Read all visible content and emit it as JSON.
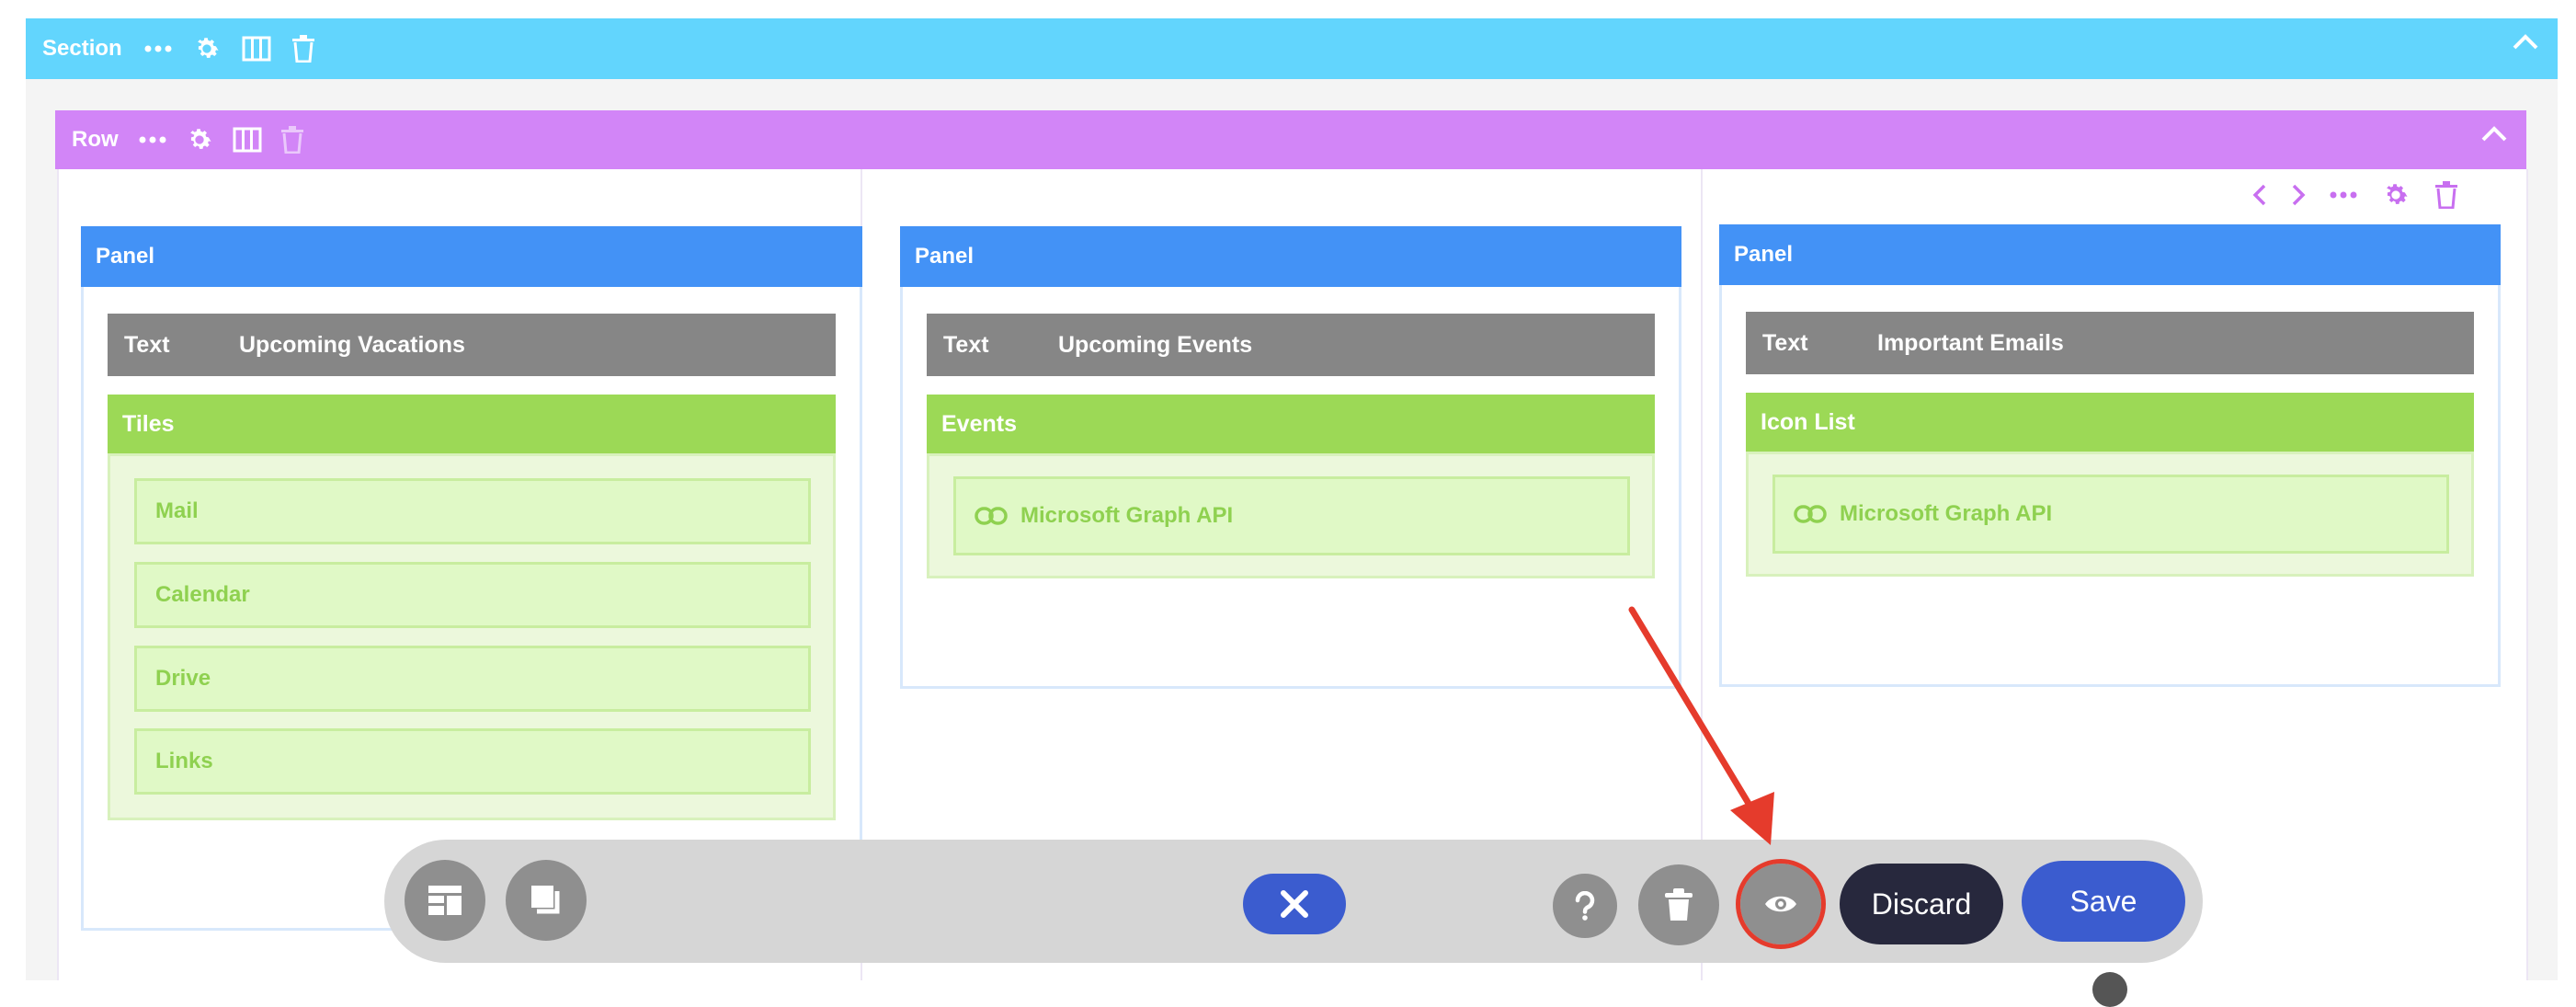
{
  "colors": {
    "section": "#62d5fd",
    "row": "#d285f7",
    "panel": "#4392f6",
    "text_block": "#868686",
    "green": "#9cd956",
    "button_blue": "#3b5ccf",
    "discard": "#27283d",
    "annotation_red": "#e53b2c"
  },
  "section": {
    "label": "Section",
    "icons": [
      "more-icon",
      "gear-icon",
      "columns-icon",
      "trash-icon",
      "chevron-up-icon"
    ]
  },
  "row": {
    "label": "Row",
    "icons": [
      "more-icon",
      "gear-icon",
      "columns-icon",
      "trash-icon",
      "chevron-up-icon"
    ]
  },
  "column_tools": {
    "icons": [
      "chevron-left-icon",
      "chevron-right-icon",
      "more-icon",
      "gear-icon",
      "trash-icon"
    ]
  },
  "panels": [
    {
      "header": "Panel",
      "text_label": "Text",
      "text_value": "Upcoming Vacations",
      "module": "Tiles",
      "items": [
        "Mail",
        "Calendar",
        "Drive",
        "Links"
      ]
    },
    {
      "header": "Panel",
      "text_label": "Text",
      "text_value": "Upcoming Events",
      "module": "Events",
      "items": [
        "Microsoft Graph API"
      ]
    },
    {
      "header": "Panel",
      "text_label": "Text",
      "text_value": "Important Emails",
      "module": "Icon List",
      "items": [
        "Microsoft Graph API"
      ]
    }
  ],
  "toolbar": {
    "icons": [
      "layout-icon",
      "duplicate-icon",
      "close-icon",
      "help-icon",
      "trash-icon",
      "eye-icon"
    ],
    "discard_label": "Discard",
    "save_label": "Save"
  }
}
